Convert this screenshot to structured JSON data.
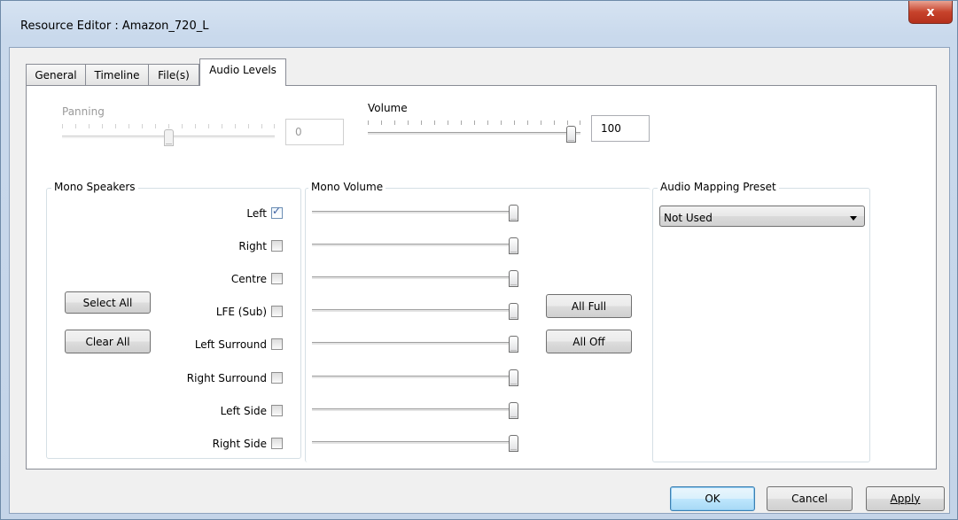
{
  "window": {
    "title": "Resource Editor  :  Amazon_720_L",
    "close_glyph": "x"
  },
  "tabs": [
    {
      "label": "General",
      "active": false
    },
    {
      "label": "Timeline",
      "active": false
    },
    {
      "label": "File(s)",
      "active": false
    },
    {
      "label": "Audio Levels",
      "active": true
    }
  ],
  "panning": {
    "label": "Panning",
    "value": "0",
    "enabled": false,
    "position": 0.5
  },
  "volume": {
    "label": "Volume",
    "value": "100",
    "enabled": true,
    "position": 1.0
  },
  "mono_speakers": {
    "title": "Mono Speakers",
    "select_all": "Select All",
    "clear_all": "Clear All",
    "speakers": [
      {
        "label": "Left",
        "checked": true
      },
      {
        "label": "Right",
        "checked": false
      },
      {
        "label": "Centre",
        "checked": false
      },
      {
        "label": "LFE (Sub)",
        "checked": false
      },
      {
        "label": "Left Surround",
        "checked": false
      },
      {
        "label": "Right Surround",
        "checked": false
      },
      {
        "label": "Left Side",
        "checked": false
      },
      {
        "label": "Right Side",
        "checked": false
      }
    ]
  },
  "mono_volume": {
    "title": "Mono Volume",
    "all_full": "All Full",
    "all_off": "All Off",
    "levels": [
      1,
      1,
      1,
      1,
      1,
      1,
      1,
      1
    ]
  },
  "audio_mapping": {
    "title": "Audio Mapping Preset",
    "selected": "Not Used"
  },
  "footer": {
    "ok": "OK",
    "cancel": "Cancel",
    "apply": "Apply"
  },
  "colors": {
    "title_gradient_top": "#d6e3f2",
    "close_red": "#c7432c",
    "default_button_blue": "#3c7fb1",
    "checkmark": "#3b5fa0"
  }
}
